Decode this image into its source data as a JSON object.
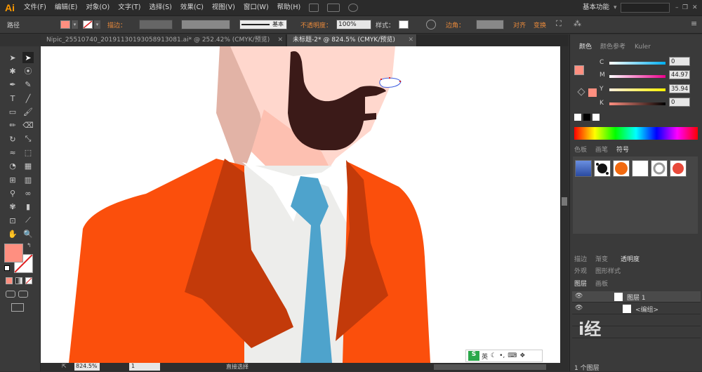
{
  "app": {
    "logo": "Ai",
    "workspace": "基本功能"
  },
  "menu": [
    "文件(F)",
    "编辑(E)",
    "对象(O)",
    "文字(T)",
    "选择(S)",
    "效果(C)",
    "视图(V)",
    "窗口(W)",
    "帮助(H)"
  ],
  "control": {
    "selection": "路径",
    "stroke_label": "描边：",
    "stroke_style": "基本",
    "opacity_label": "不透明度：",
    "opacity": "100%",
    "style_label": "样式：",
    "corner_label": "边角：",
    "align": "对齐",
    "transform": "变换"
  },
  "colors": {
    "fill": "#ff8f80",
    "jacket": "#fb4f0c",
    "lapel": "#c33a0a",
    "tie": "#4ea3cc",
    "shirt": "#ededeb",
    "skin": "#ffd7cd",
    "beard": "#3b1a18"
  },
  "tabs": [
    {
      "label": "Nipic_25510740_20191130193058913081.ai* @ 252.42% (CMYK/预览)"
    },
    {
      "label": "未标题-2* @ 824.5% (CMYK/预览)"
    }
  ],
  "status": {
    "zoom": "824.5%",
    "page": "1",
    "tool": "直接选择"
  },
  "color_panel": {
    "tabs": [
      "颜色",
      "颜色参考",
      "Kuler"
    ],
    "C": "0",
    "M": "44.97",
    "Y": "35.94",
    "K": "0"
  },
  "swatch_panel": {
    "tabs": [
      "色板",
      "画笔",
      "符号"
    ]
  },
  "stroke_panel": {
    "tabs": [
      "描边",
      "渐变",
      "透明度"
    ]
  },
  "appearance_panel": {
    "tabs": [
      "外观",
      "图形样式"
    ]
  },
  "layers_panel": {
    "tabs": [
      "图层",
      "画板"
    ],
    "layer_name": "图层 1",
    "sublayer": "<编组>",
    "footer": "1 个图层"
  },
  "ime": {
    "lang": "英"
  },
  "watermark": "i经"
}
